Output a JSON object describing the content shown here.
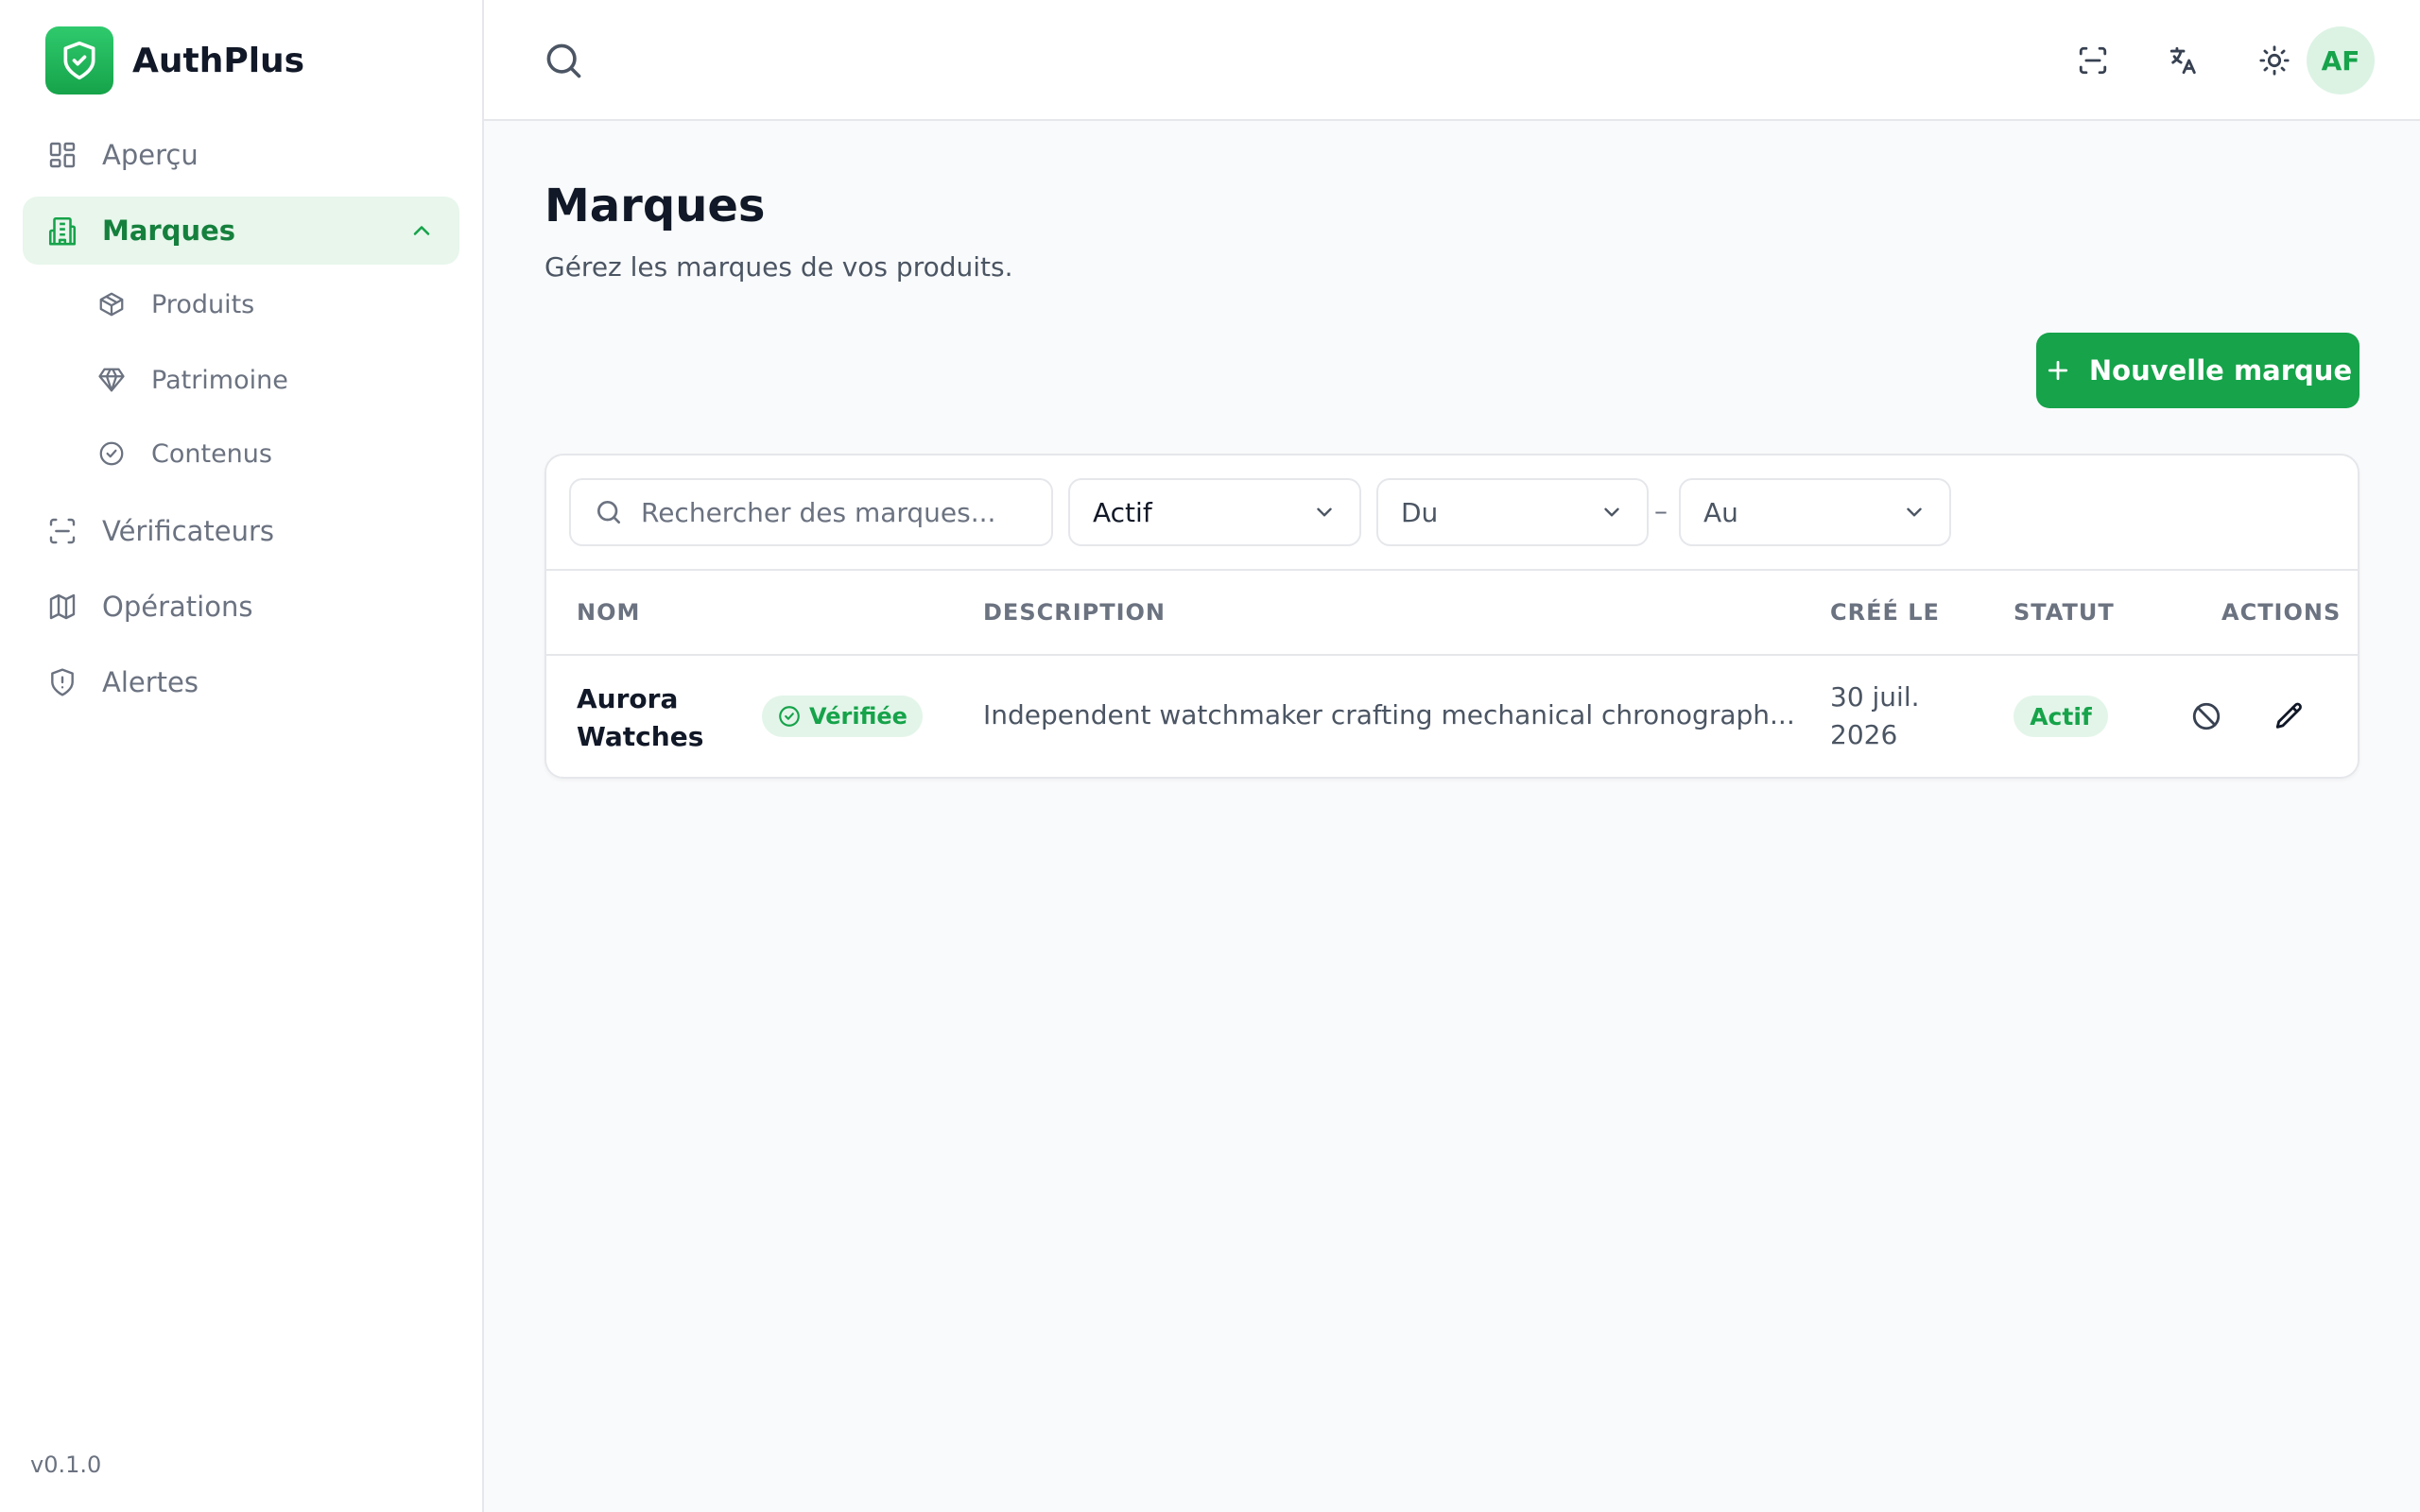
{
  "app": {
    "name": "AuthPlus",
    "version": "v0.1.0",
    "accent": "#16a34a"
  },
  "sidebar": {
    "items": [
      {
        "label": "Aperçu",
        "icon": "dashboard-icon"
      },
      {
        "label": "Marques",
        "icon": "building-icon",
        "active": true,
        "expanded": true
      },
      {
        "label": "Vérificateurs",
        "icon": "scan-icon"
      },
      {
        "label": "Opérations",
        "icon": "map-icon"
      },
      {
        "label": "Alertes",
        "icon": "shield-alert-icon"
      }
    ],
    "subitems": [
      {
        "label": "Produits",
        "icon": "package-icon"
      },
      {
        "label": "Patrimoine",
        "icon": "gem-icon"
      },
      {
        "label": "Contenus",
        "icon": "badge-check-icon"
      }
    ]
  },
  "topbar": {
    "avatar_initials": "AF"
  },
  "main": {
    "title": "Marques",
    "subtitle": "Gérez les marques de vos produits.",
    "new_button": "Nouvelle marque"
  },
  "filters": {
    "search_placeholder": "Rechercher des marques...",
    "status": "Actif",
    "from": "Du",
    "separator": "–",
    "to": "Au"
  },
  "table": {
    "headers": [
      "NOM",
      "DESCRIPTION",
      "CRÉÉ LE",
      "STATUT",
      "ACTIONS"
    ],
    "rows": [
      {
        "name_line1": "Aurora",
        "name_line2": "Watches",
        "verified": "Vérifiée",
        "description": "Independent watchmaker crafting mechanical chronograph...",
        "date_line1": "30 juil.",
        "date_line2": "2026",
        "status": "Actif"
      }
    ]
  }
}
